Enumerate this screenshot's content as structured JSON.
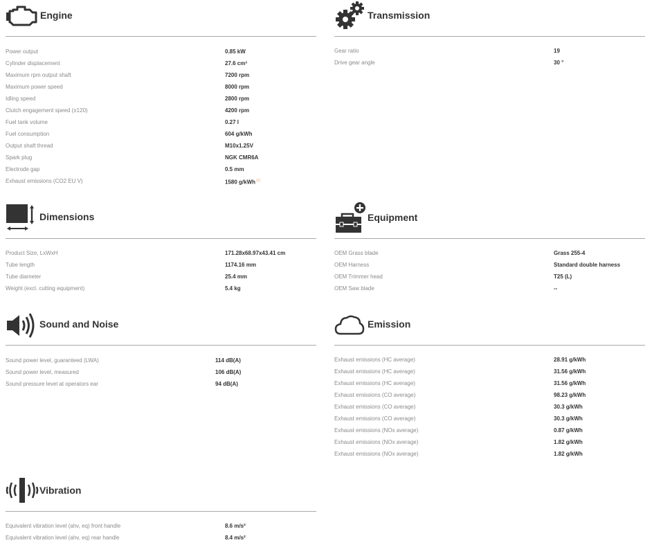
{
  "sections": {
    "engine": {
      "title": "Engine",
      "icon": "engine-icon",
      "rows": [
        {
          "label": "Power output",
          "value": "0.85 kW"
        },
        {
          "label": "Cylinder displacement",
          "value": "27.6 cm³"
        },
        {
          "label": "Maximum rpm output shaft",
          "value": "7200 rpm"
        },
        {
          "label": "Maximum power speed",
          "value": "8000 rpm"
        },
        {
          "label": "Idling speed",
          "value": "2800 rpm"
        },
        {
          "label": "Clutch engagement speed (±120)",
          "value": "4200 rpm"
        },
        {
          "label": "Fuel tank volume",
          "value": "0.27 l"
        },
        {
          "label": "Fuel consumption",
          "value": "604 g/kWh"
        },
        {
          "label": "Output shaft thread",
          "value": "M10x1.25V"
        },
        {
          "label": "Spark plug",
          "value": "NGK CMR6A"
        },
        {
          "label": "Electrode gap",
          "value": "0.5 mm"
        },
        {
          "label": "Exhaust emissions (CO2 EU V)",
          "value": "1580 g/kWh",
          "note": "(1)"
        }
      ]
    },
    "transmission": {
      "title": "Transmission",
      "icon": "gears-icon",
      "rows": [
        {
          "label": "Gear ratio",
          "value": "19"
        },
        {
          "label": "Drive gear angle",
          "value": "30 °"
        }
      ]
    },
    "dimensions": {
      "title": "Dimensions",
      "icon": "dimensions-icon",
      "rows": [
        {
          "label": "Product Size, LxWxH",
          "value": "171.28x68.97x43.41 cm"
        },
        {
          "label": "Tube length",
          "value": "1174.16 mm"
        },
        {
          "label": "Tube diameter",
          "value": "25.4 mm"
        },
        {
          "label": "Weight (excl. cutting equipment)",
          "value": "5.4 kg"
        }
      ]
    },
    "equipment": {
      "title": "Equipment",
      "icon": "toolbox-icon",
      "rows": [
        {
          "label": "OEM Grass blade",
          "value": "Grass 255-4"
        },
        {
          "label": "OEM Harness",
          "value": "Standard double harness"
        },
        {
          "label": "OEM Trimmer head",
          "value": "T25 (L)"
        },
        {
          "label": "OEM Saw blade",
          "value": "--"
        }
      ]
    },
    "sound": {
      "title": "Sound and Noise",
      "icon": "speaker-icon",
      "rows": [
        {
          "label": "Sound power level, guaranteed (LWA)",
          "value": "114 dB(A)"
        },
        {
          "label": "Sound power level, measured",
          "value": "106 dB(A)"
        },
        {
          "label": "Sound pressure level at operators ear",
          "value": "94 dB(A)"
        }
      ]
    },
    "emission": {
      "title": "Emission",
      "icon": "cloud-icon",
      "rows": [
        {
          "label": "Exhaust emissions (HC average)",
          "value": "28.91 g/kWh"
        },
        {
          "label": "Exhaust emissions (HC average)",
          "value": "31.56 g/kWh"
        },
        {
          "label": "Exhaust emissions (HC average)",
          "value": "31.56 g/kWh"
        },
        {
          "label": "Exhaust emissions (CO average)",
          "value": "98.23 g/kWh"
        },
        {
          "label": "Exhaust emissions (CO average)",
          "value": "30.3 g/kWh"
        },
        {
          "label": "Exhaust emissions (CO average)",
          "value": "30.3 g/kWh"
        },
        {
          "label": "Exhaust emissions (NOx average)",
          "value": "0.87 g/kWh"
        },
        {
          "label": "Exhaust emissions (NOx average)",
          "value": "1.82 g/kWh"
        },
        {
          "label": "Exhaust emissions (NOx average)",
          "value": "1.82 g/kWh"
        }
      ]
    },
    "vibration": {
      "title": "Vibration",
      "icon": "vibration-icon",
      "rows": [
        {
          "label": "Equivalent vibration level (ahv, eq) front handle",
          "value": "8.6 m/s²"
        },
        {
          "label": "Equivalent vibration level (ahv, eq) rear handle",
          "value": "8.4 m/s²"
        }
      ]
    }
  }
}
